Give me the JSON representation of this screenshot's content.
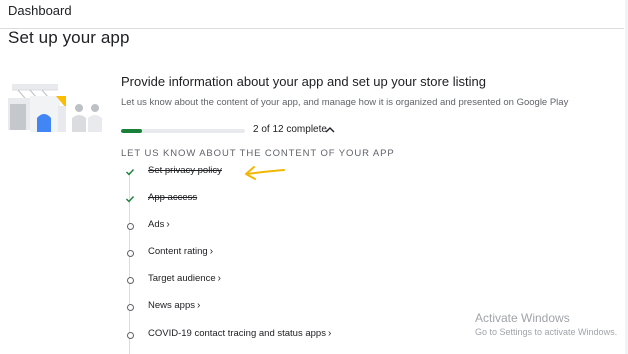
{
  "breadcrumb": "Dashboard",
  "page_title": "Set up your app",
  "section": {
    "title": "Provide information about your app and set up your store listing",
    "subtitle": "Let us know about the content of your app, and manage how it is organized and presented on Google Play",
    "progress": {
      "completed": 2,
      "total": 12,
      "label": "2 of 12 complete"
    }
  },
  "group_heading": "LET US KNOW ABOUT THE CONTENT OF YOUR APP",
  "tasks": [
    {
      "label": "Set privacy policy",
      "done": true
    },
    {
      "label": "App access",
      "done": true
    },
    {
      "label": "Ads",
      "done": false
    },
    {
      "label": "Content rating",
      "done": false
    },
    {
      "label": "Target audience",
      "done": false
    },
    {
      "label": "News apps",
      "done": false
    },
    {
      "label": "COVID-19 contact tracing and status apps",
      "done": false
    }
  ],
  "watermark": {
    "line1": "Activate Windows",
    "line2": "Go to Settings to activate Windows."
  },
  "colors": {
    "accent_green": "#188038",
    "annotation_arrow": "#f2b705",
    "illustration_blue": "#4285f4",
    "illustration_yellow": "#fbbc04"
  }
}
